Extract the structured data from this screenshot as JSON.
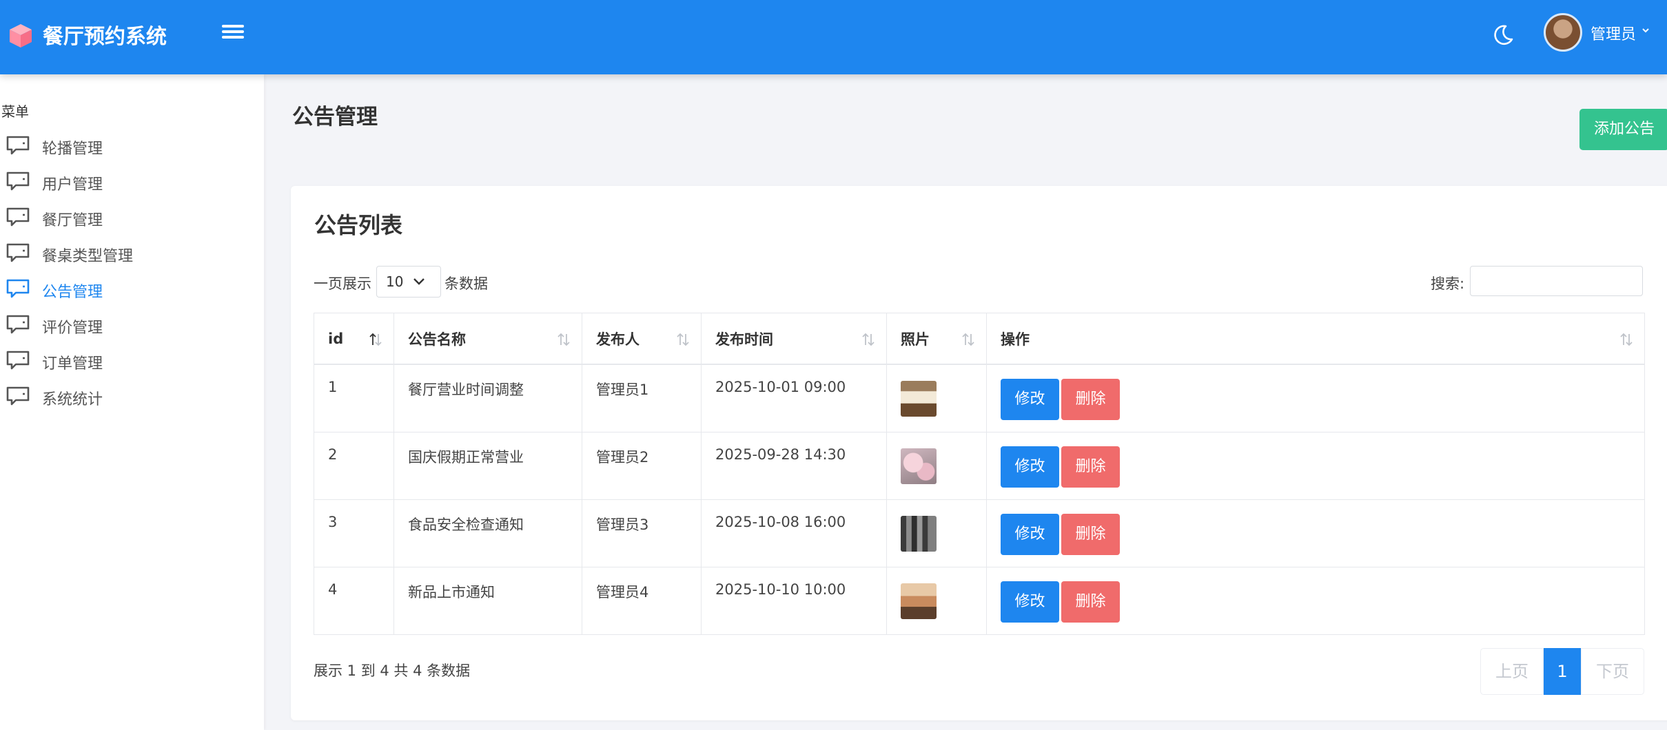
{
  "app": {
    "title": "餐厅预约系统"
  },
  "header": {
    "user_name": "管理员"
  },
  "sidebar": {
    "label": "菜单",
    "items": [
      {
        "label": "轮播管理",
        "active": false
      },
      {
        "label": "用户管理",
        "active": false
      },
      {
        "label": "餐厅管理",
        "active": false
      },
      {
        "label": "餐桌类型管理",
        "active": false
      },
      {
        "label": "公告管理",
        "active": true
      },
      {
        "label": "评价管理",
        "active": false
      },
      {
        "label": "订单管理",
        "active": false
      },
      {
        "label": "系统统计",
        "active": false
      }
    ]
  },
  "main": {
    "page_title": "公告管理",
    "add_button": "添加公告",
    "card_title": "公告列表",
    "length_prefix": "一页展示",
    "length_value": "10",
    "length_suffix": "条数据",
    "search_label": "搜索:",
    "search_value": "",
    "table": {
      "columns": [
        "id",
        "公告名称",
        "发布人",
        "发布时间",
        "照片",
        "操作"
      ],
      "rows": [
        {
          "id": "1",
          "name": "餐厅营业时间调整",
          "publisher": "管理员1",
          "time": "2025-10-01 09:00",
          "photo": "book-photo"
        },
        {
          "id": "2",
          "name": "国庆假期正常营业",
          "publisher": "管理员2",
          "time": "2025-09-28 14:30",
          "photo": "blossom-photo"
        },
        {
          "id": "3",
          "name": "食品安全检查通知",
          "publisher": "管理员3",
          "time": "2025-10-08 16:00",
          "photo": "building-photo"
        },
        {
          "id": "4",
          "name": "新品上市通知",
          "publisher": "管理员4",
          "time": "2025-10-10 10:00",
          "photo": "sunset-photo"
        }
      ],
      "edit_label": "修改",
      "delete_label": "删除"
    },
    "info_text": "展示 1 到 4 共 4 条数据",
    "pagination": {
      "prev": "上页",
      "current": "1",
      "next": "下页"
    }
  },
  "colors": {
    "primary": "#1e86ef",
    "success": "#34c38f",
    "danger": "#f06b6b"
  }
}
